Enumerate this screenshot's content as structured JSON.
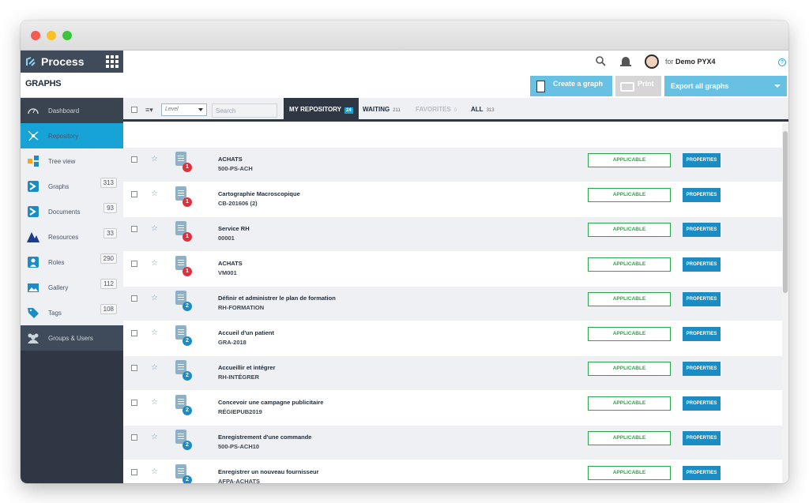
{
  "app": {
    "name": "Process",
    "section_title": "GRAPHS"
  },
  "header": {
    "user_prefix": "for",
    "user_name": "Demo PYX4",
    "help": "?"
  },
  "actions": {
    "create": "Create a graph",
    "print": "Print",
    "export": "Export all graphs"
  },
  "sidebar": {
    "top": {
      "label": "Dashboard"
    },
    "items": [
      {
        "label": "Repository",
        "count": ""
      },
      {
        "label": "Tree view",
        "count": ""
      },
      {
        "label": "Graphs",
        "count": "313"
      },
      {
        "label": "Documents",
        "count": "93"
      },
      {
        "label": "Resources",
        "count": "33"
      },
      {
        "label": "Roles",
        "count": "290"
      },
      {
        "label": "Gallery",
        "count": "112"
      },
      {
        "label": "Tags",
        "count": "108"
      }
    ],
    "groups": {
      "label": "Groups & Users"
    }
  },
  "filters": {
    "level_placeholder": "Level",
    "search_placeholder": "Search",
    "tabs": [
      {
        "label": "MY REPOSITORY",
        "count": "24"
      },
      {
        "label": "WAITING",
        "count": "211"
      },
      {
        "label": "FAVORITES",
        "count": "0"
      },
      {
        "label": "ALL",
        "count": "313"
      }
    ]
  },
  "rows": [
    {
      "title": "ACHATS",
      "code": "500-PS-ACH",
      "badge": "1",
      "badge_color": "red",
      "status": "APPLICABLE",
      "action": "PROPERTIES"
    },
    {
      "title": "Cartographie Macroscopique",
      "code": "CB-201606 (2)",
      "badge": "1",
      "badge_color": "red",
      "status": "APPLICABLE",
      "action": "PROPERTIES"
    },
    {
      "title": "Service RH",
      "code": "00001",
      "badge": "1",
      "badge_color": "red",
      "status": "APPLICABLE",
      "action": "PROPERTIES"
    },
    {
      "title": "ACHATS",
      "code": "VM001",
      "badge": "1",
      "badge_color": "red",
      "status": "APPLICABLE",
      "action": "PROPERTIES"
    },
    {
      "title": "Définir et administrer le plan de formation",
      "code": "RH-FORMATION",
      "badge": "2",
      "badge_color": "blue",
      "status": "APPLICABLE",
      "action": "PROPERTIES"
    },
    {
      "title": "Accueil d'un patient",
      "code": "GRA-2018",
      "badge": "2",
      "badge_color": "blue",
      "status": "APPLICABLE",
      "action": "PROPERTIES"
    },
    {
      "title": "Accueillir et intégrer",
      "code": "RH-INTÉGRER",
      "badge": "2",
      "badge_color": "blue",
      "status": "APPLICABLE",
      "action": "PROPERTIES"
    },
    {
      "title": "Concevoir une campagne publicitaire",
      "code": "RÉGIEPUB2019",
      "badge": "2",
      "badge_color": "blue",
      "status": "APPLICABLE",
      "action": "PROPERTIES"
    },
    {
      "title": "Enregistrement d'une commande",
      "code": "500-PS-ACH10",
      "badge": "2",
      "badge_color": "blue",
      "status": "APPLICABLE",
      "action": "PROPERTIES"
    },
    {
      "title": "Enregistrer un nouveau fournisseur",
      "code": "AFPA-ACHATS",
      "badge": "2",
      "badge_color": "blue",
      "status": "APPLICABLE",
      "action": "PROPERTIES"
    }
  ],
  "colors": {
    "accent": "#18a3d6",
    "sidebar": "#2f3744",
    "applicable": "#27a846",
    "badge_red": "#e0303e",
    "badge_blue": "#1c8cc4"
  }
}
